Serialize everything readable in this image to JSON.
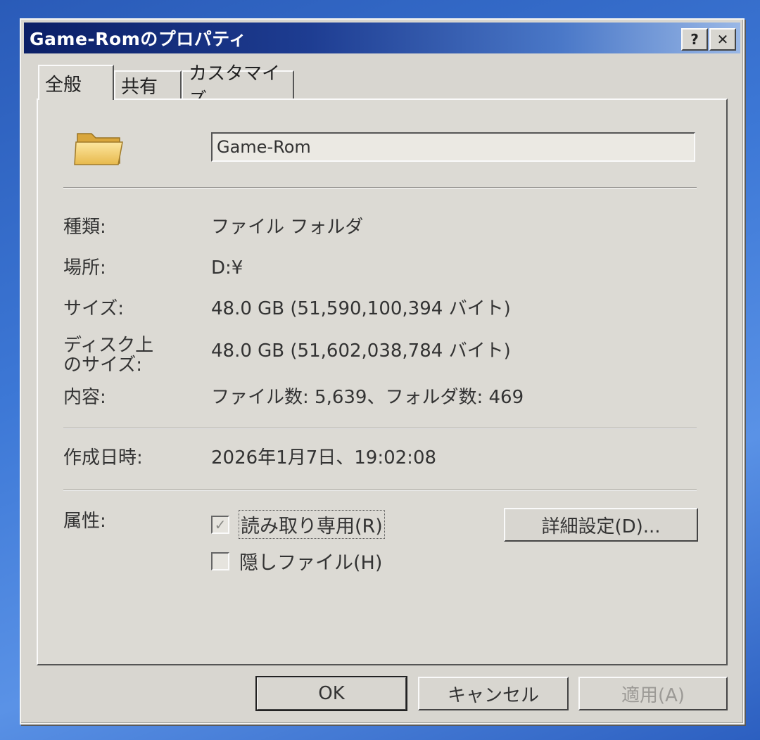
{
  "window": {
    "title": "Game-Romのプロパティ",
    "help_button": "?",
    "close_button": "✕"
  },
  "tabs": [
    {
      "label": "全般",
      "active": true
    },
    {
      "label": "共有",
      "active": false
    },
    {
      "label": "カスタマイズ",
      "active": false
    }
  ],
  "general": {
    "folder_name": "Game-Rom",
    "type_label": "種類:",
    "type_value": "ファイル フォルダ",
    "location_label": "場所:",
    "location_value": "D:¥",
    "size_label": "サイズ:",
    "size_value": "48.0 GB (51,590,100,394 バイト)",
    "disk_size_label_1": "ディスク上",
    "disk_size_label_2": "のサイズ:",
    "disk_size_value": "48.0 GB (51,602,038,784 バイト)",
    "contents_label": "内容:",
    "contents_value": "ファイル数: 5,639、フォルダ数: 469",
    "created_label": "作成日時:",
    "created_value": "2026年1月7日、19:02:08",
    "attributes_label": "属性:",
    "readonly_label": "読み取り専用(R)",
    "readonly_checked": true,
    "hidden_label": "隠しファイル(H)",
    "hidden_checked": false,
    "advanced_button": "詳細設定(D)..."
  },
  "footer": {
    "ok": "OK",
    "cancel": "キャンセル",
    "apply": "適用(A)"
  },
  "icons": {
    "folder": "folder-icon",
    "check": "✓"
  }
}
